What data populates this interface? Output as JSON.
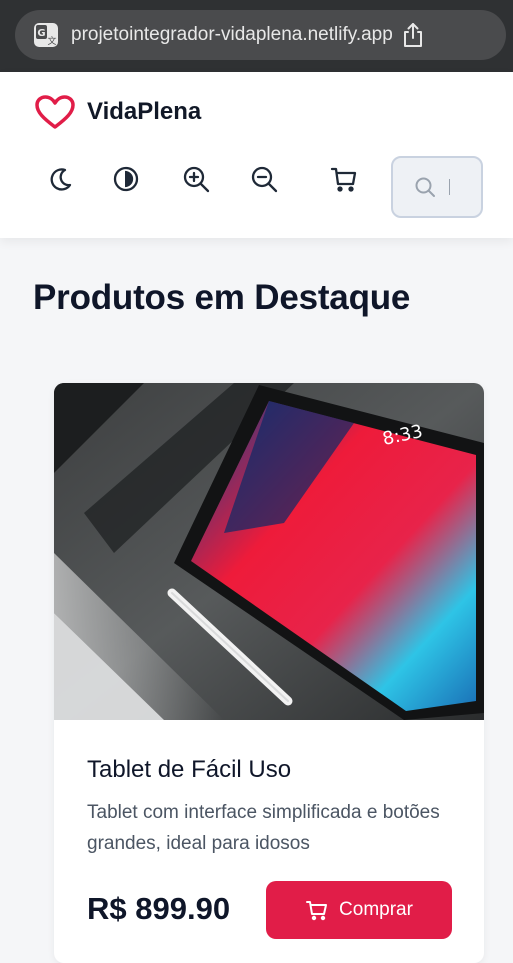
{
  "browser": {
    "url": "projetointegrador-vidaplena.netlify.app"
  },
  "header": {
    "brand_name": "VidaPlena",
    "toolbar": [
      {
        "name": "theme-toggle",
        "icon": "moon-icon"
      },
      {
        "name": "contrast-toggle",
        "icon": "contrast-icon"
      },
      {
        "name": "zoom-in",
        "icon": "zoom-in-icon"
      },
      {
        "name": "zoom-out",
        "icon": "zoom-out-icon"
      },
      {
        "name": "cart",
        "icon": "cart-icon"
      }
    ],
    "search_placeholder": ""
  },
  "main": {
    "section_title": "Produtos em Destaque",
    "products": [
      {
        "name": "Tablet de Fácil Uso",
        "description": "Tablet com interface simplificada e botões grandes, ideal para idosos",
        "price": "R$ 899.90",
        "buy_label": "Comprar",
        "screen_time": "8:33"
      }
    ]
  },
  "colors": {
    "accent": "#e11d48",
    "text_dark": "#0f1629",
    "browser_bar": "#2f3133"
  }
}
